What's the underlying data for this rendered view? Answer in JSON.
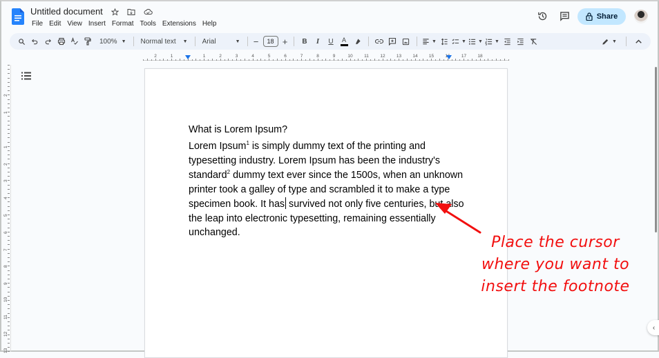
{
  "header": {
    "title": "Untitled document",
    "title_icons": [
      "star-icon",
      "move-to-folder-icon",
      "cloud-saved-icon"
    ],
    "menu": [
      "File",
      "Edit",
      "View",
      "Insert",
      "Format",
      "Tools",
      "Extensions",
      "Help"
    ],
    "share_label": "Share",
    "right_icons": [
      "version-history-icon",
      "comments-icon"
    ]
  },
  "toolbar": {
    "zoom": "100%",
    "style": "Normal text",
    "font": "Arial",
    "font_size": "18",
    "icons": [
      "search-menus",
      "undo",
      "redo",
      "print",
      "spellcheck",
      "paint-format",
      "bold",
      "italic",
      "underline",
      "text-color",
      "highlight",
      "link",
      "add-comment",
      "insert-image",
      "align",
      "line-spacing",
      "checklist",
      "bulleted-list",
      "numbered-list",
      "decrease-indent",
      "increase-indent",
      "clear-formatting",
      "editing-mode",
      "hide-menus"
    ],
    "text_color": "#000000"
  },
  "ruler": {
    "horizontal_labels": [
      "2",
      "1",
      "1",
      "2",
      "3",
      "4",
      "5",
      "6",
      "7",
      "8",
      "9",
      "10",
      "11",
      "12",
      "13",
      "14",
      "15",
      "16",
      "17",
      "18"
    ],
    "vertical_labels": [
      "2",
      "1",
      "1",
      "2",
      "3",
      "4",
      "5",
      "6",
      "7",
      "8",
      "9",
      "10",
      "11",
      "12",
      "13"
    ]
  },
  "document": {
    "heading": "What is Lorem Ipsum?",
    "body": {
      "p1": "Lorem Ipsum",
      "sup1": "1",
      "p2": " is simply dummy text of the printing and typesetting industry. Lorem Ipsum has been the industry's standard",
      "sup2": "2",
      "p3": " dummy text ever since the 1500s, when an unknown printer took a galley of type and scrambled it to make a type specimen book. It has",
      "p4": " survived not only five centuries, but also the leap into electronic typesetting, remaining essentially unchanged."
    }
  },
  "annotation": {
    "line1": "Place the cursor",
    "line2": "where you want to",
    "line3": "insert the footnote",
    "color": "#f20f0f"
  }
}
